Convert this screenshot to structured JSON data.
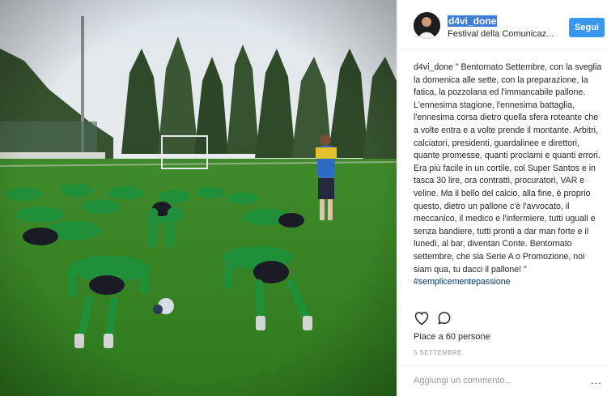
{
  "header": {
    "username": "d4vi_done",
    "location": "Festival della Comunicaz...",
    "follow_label": "Segui"
  },
  "caption": {
    "username": "d4vi_done",
    "text": " \" Bentornato Settembre, con la sveglia la domenica alle sette, con la preparazione, la fatica, la pozzolana ed l'immancabile pallone. L'ennesima stagione, l'ennesima battaglia, l'ennesima corsa dietro quella sfera roteante che a volte entra e a volte prende il montante. Arbitri, calciatori, presidenti, guardalinee e direttori, quante promesse, quanti proclami e quanti errori. Era più facile in un cortile, col Super Santos e in tasca 30 lire, ora contratti, procuratori, VAR e veline. Ma il bello del calcio, alla fine, è proprio questo, dietro un pallone c'è l'avvocato, il meccanico, il medico e l'infermiere, tutti uguali e senza bandiere, tutti pronti a dar man forte e il lunedì, al bar, diventan Conte. Bentornato settembre, che sia Serie A o Promozione, noi siam qua, tu dacci il pallone! \" ",
    "hashtag": "#semplicementepassione"
  },
  "actions": {
    "like_icon": "heart-outline-icon",
    "comment_icon": "speech-bubble-icon"
  },
  "likes": "Piace a 60 persone",
  "date": "5 SETTEMBRE",
  "comment": {
    "placeholder": "Aggiungi un commento...",
    "more_label": "..."
  }
}
